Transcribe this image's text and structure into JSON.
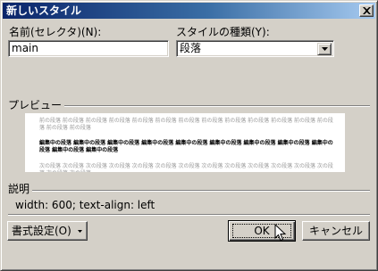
{
  "window": {
    "title": "新しいスタイル",
    "close_icon": "close-icon"
  },
  "name_field": {
    "label": "名前(セレクタ)(N):",
    "value": "main"
  },
  "style_type": {
    "label": "スタイルの種類(Y):",
    "selected": "段落",
    "arrow_icon": "chevron-down-icon"
  },
  "preview": {
    "title": "プレビュー",
    "prev_paragraph": "前の段落 前の段落 前の段落 前の段落 前の段落 前の段落 前の段落 前の段落 前の段落 前の段落 前の段落 前の段落 前の段落 前の段落 前の段落",
    "current_paragraph": "編集中の段落 編集中の段落 編集中の段落 編集中の段落 編集中の段落 編集中の段落 編集中の段落 編集中の段落 編集中の段落 編集中の段落 編集中の段落",
    "next_paragraph": "次の段落 次の段落 次の段落 次の段落 次の段落 次の段落 次の段落 次の段落 次の段落 次の段落 次の段落 次の段落 次の段落 次の段落 次の段落"
  },
  "description": {
    "title": "説明",
    "text": "width: 600; text-align: left"
  },
  "buttons": {
    "format_label": "書式設定(O)",
    "format_arrow_icon": "dropdown-arrow-icon",
    "ok_label": "OK",
    "cancel_label": "キャンセル"
  },
  "cursor_icon": "mouse-pointer-icon"
}
